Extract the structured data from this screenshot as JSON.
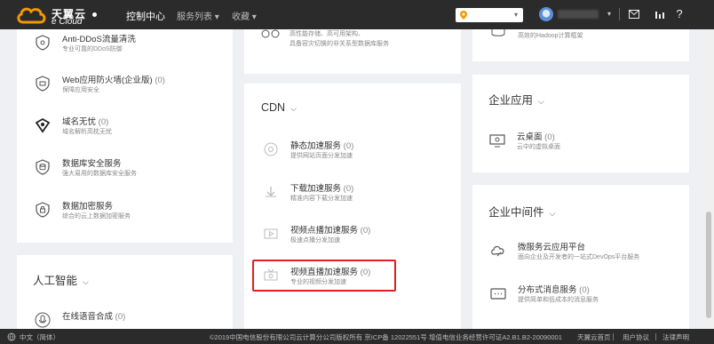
{
  "header": {
    "brand": "天翼云",
    "brand_sub": "e Cloud",
    "nav_console": "控制中心",
    "nav_services": "服务列表 ▾",
    "nav_favorites": "收藏 ▾",
    "region_caret": "▾",
    "account_caret": "▾"
  },
  "left_card": {
    "items": [
      {
        "title": "Anti-DDoS流量清洗",
        "count": "",
        "desc": "专业可靠的DDoS防御"
      },
      {
        "title": "Web应用防火墙(企业版)",
        "count": "(0)",
        "desc": "保障应用安全"
      },
      {
        "title": "域名无忧",
        "count": "(0)",
        "desc": "域名解析高枕无忧"
      },
      {
        "title": "数据库安全服务",
        "count": "",
        "desc": "强大易用的数据库安全服务"
      },
      {
        "title": "数据加密服务",
        "count": "",
        "desc": "综合的云上数据加密服务"
      }
    ]
  },
  "left_bottom": {
    "section_title": "人工智能",
    "item": {
      "title": "在线语音合成",
      "count": "(0)"
    }
  },
  "mid_top": {
    "line1": "高性能存储、高可用架构、",
    "line2": "具备容灾切换的非关系型数据库服务"
  },
  "cdn": {
    "section_title": "CDN",
    "items": [
      {
        "title": "静态加速服务",
        "count": "(0)",
        "desc": "提供网站页面分发加速"
      },
      {
        "title": "下载加速服务",
        "count": "(0)",
        "desc": "精准内容下载分发加速"
      },
      {
        "title": "视频点播加速服务",
        "count": "(0)",
        "desc": "极速点播分发加速"
      },
      {
        "title": "视频直播加速服务",
        "count": "(0)",
        "desc": "专业的视频分发加速"
      }
    ]
  },
  "right_top": {
    "desc": "高效的Hadoop计算框架"
  },
  "enterprise_apps": {
    "section_title": "企业应用",
    "item": {
      "title": "云桌面",
      "count": "(0)",
      "desc": "云中的虚拟桌面"
    }
  },
  "middleware": {
    "section_title": "企业中间件",
    "items": [
      {
        "title": "微服务云应用平台",
        "count": "",
        "desc": "面向企业及开发者的一站式DevOps平台服务"
      },
      {
        "title": "分布式消息服务",
        "count": "(0)",
        "desc": "提供简单和低成本的消息服务"
      }
    ]
  },
  "footer": {
    "language": "中文（简体）",
    "copyright": "©2019中国电信股份有限公司云计算分公司版权所有  京ICP备 12022551号  增值电信业务经营许可证A2.B1.B2-20090001",
    "home": "天翼云首页",
    "agreement": "用户协议",
    "legal": "法律声明"
  },
  "colors": {
    "highlight": "#e02020",
    "topbar": "#2b2b2b",
    "accent": "#f39800"
  }
}
